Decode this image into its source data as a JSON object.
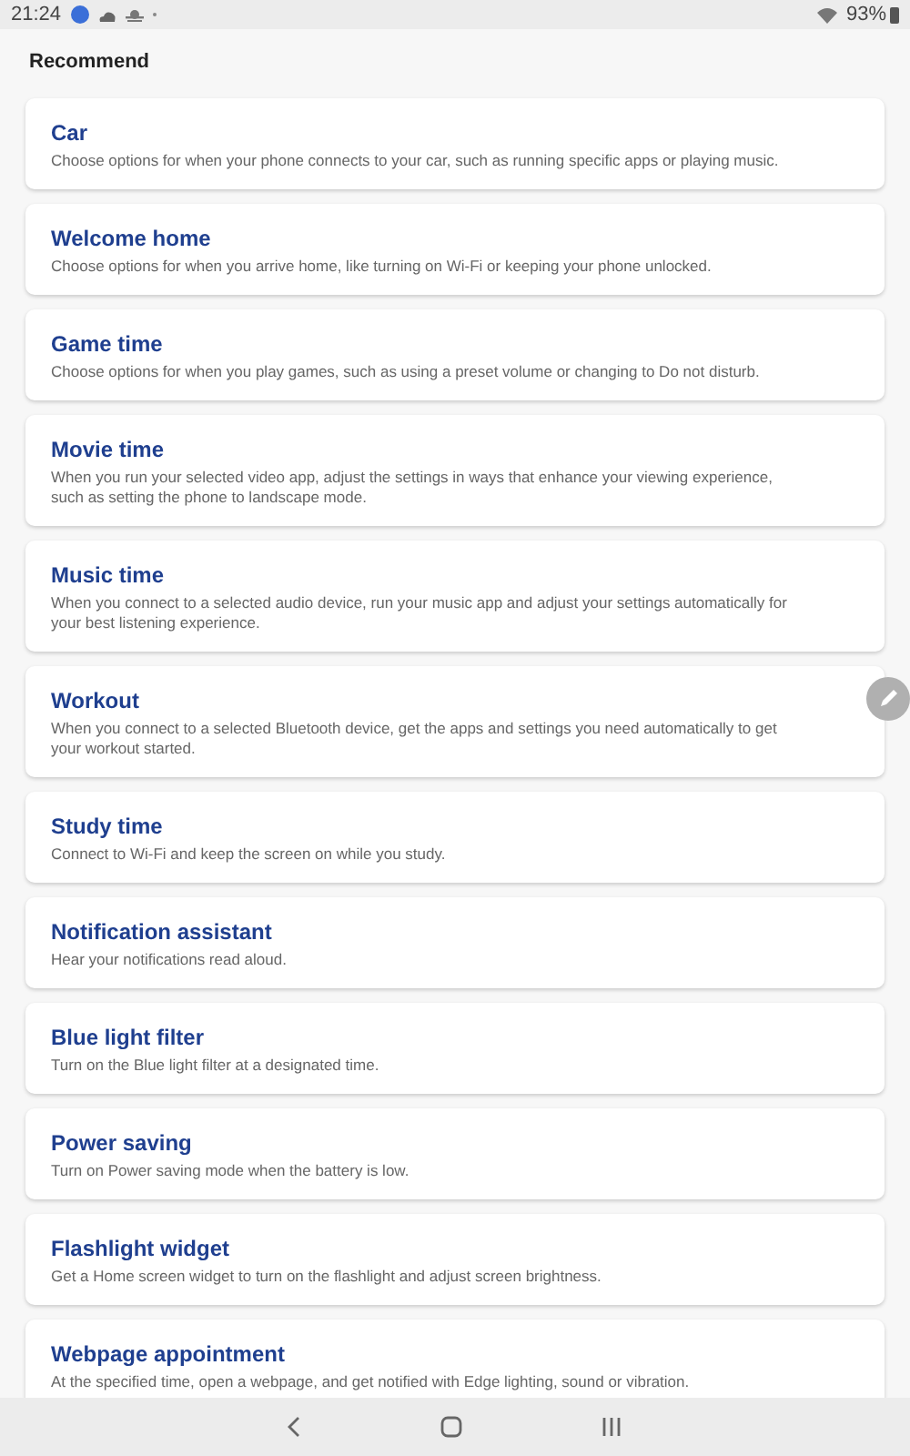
{
  "status_bar": {
    "time": "21:24",
    "battery": "93%"
  },
  "heading": "Recommend",
  "cards": [
    {
      "title": "Car",
      "description": "Choose options for when your phone connects to your car, such as running specific apps or playing music."
    },
    {
      "title": "Welcome home",
      "description": "Choose options for when you arrive home, like turning on Wi-Fi or keeping your phone unlocked."
    },
    {
      "title": "Game time",
      "description": "Choose options for when you play games, such as using a preset volume or changing to Do not disturb."
    },
    {
      "title": "Movie time",
      "description": "When you run your selected video app, adjust the settings in ways that enhance your viewing experience, such as setting the phone to landscape mode."
    },
    {
      "title": "Music time",
      "description": "When you connect to a selected audio device, run your music app and adjust your settings automatically for your best listening experience."
    },
    {
      "title": "Workout",
      "description": "When you connect to a selected Bluetooth device, get the apps and settings you need automatically to get your workout started."
    },
    {
      "title": "Study time",
      "description": "Connect to Wi-Fi and keep the screen on while you study."
    },
    {
      "title": "Notification assistant",
      "description": "Hear your notifications read aloud."
    },
    {
      "title": "Blue light filter",
      "description": "Turn on the Blue light filter at a designated time."
    },
    {
      "title": "Power saving",
      "description": "Turn on Power saving mode when the battery is low."
    },
    {
      "title": "Flashlight widget",
      "description": "Get a Home screen widget to turn on the flashlight and adjust screen brightness."
    },
    {
      "title": "Webpage appointment",
      "description": "At the specified time, open a webpage, and get notified with Edge lighting, sound or vibration."
    }
  ]
}
